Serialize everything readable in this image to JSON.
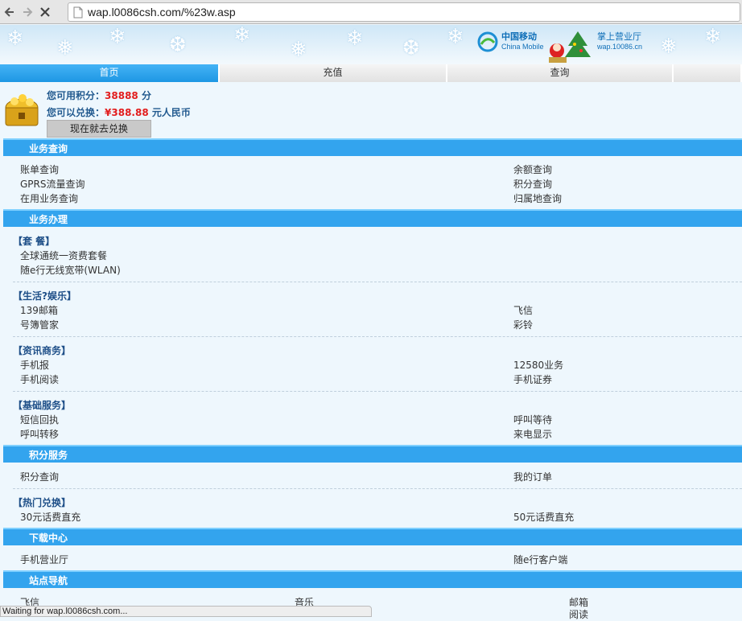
{
  "browser": {
    "url": "wap.l0086csh.com/%23w.asp"
  },
  "banner": {
    "logo_cn": "中国移动",
    "logo_en": "China Mobile",
    "hall_cn": "掌上营业厅",
    "hall_en": "wap.10086.cn"
  },
  "tabs": [
    {
      "label": "首页"
    },
    {
      "label": "充值"
    },
    {
      "label": "查询"
    },
    {
      "label": ""
    }
  ],
  "user": {
    "points_label": "您可用积分：",
    "points_value": "38888",
    "points_unit": " 分",
    "exchange_label": "您可以兑换：",
    "exchange_value": "¥388.88",
    "exchange_unit": " 元人民币",
    "exchange_button": "现在就去兑换"
  },
  "sections": {
    "query": {
      "title": "业务查询",
      "links": [
        "账单查询",
        "余额查询",
        "GPRS流量查询",
        "积分查询",
        "在用业务查询",
        "归属地查询"
      ]
    },
    "handle": {
      "title": "业务办理",
      "packages": {
        "label": "【套 餐】",
        "links": [
          "全球通统一资费套餐",
          "随e行无线宽带(WLAN)"
        ]
      },
      "life": {
        "label": "【生活?娱乐】",
        "links": [
          "139邮箱",
          "飞信",
          "号簿管家",
          "彩铃"
        ]
      },
      "info": {
        "label": "【资讯商务】",
        "links": [
          "手机报",
          "12580业务",
          "手机阅读",
          "手机证券"
        ]
      },
      "basic": {
        "label": "【基础服务】",
        "links": [
          "短信回执",
          "呼叫等待",
          "呼叫转移",
          "来电显示"
        ]
      }
    },
    "points": {
      "title": "积分服务",
      "links": [
        "积分查询",
        "我的订单"
      ],
      "hot": {
        "label": "【热门兑换】",
        "links": [
          "30元话费直充",
          "50元话费直充"
        ]
      }
    },
    "download": {
      "title": "下载中心",
      "links": [
        "手机营业厅",
        "随e行客户端"
      ]
    },
    "sitenav": {
      "title": "站点导航",
      "links": [
        "飞信",
        "音乐",
        "邮箱",
        "阅读"
      ]
    }
  },
  "status": "Waiting for wap.l0086csh.com..."
}
